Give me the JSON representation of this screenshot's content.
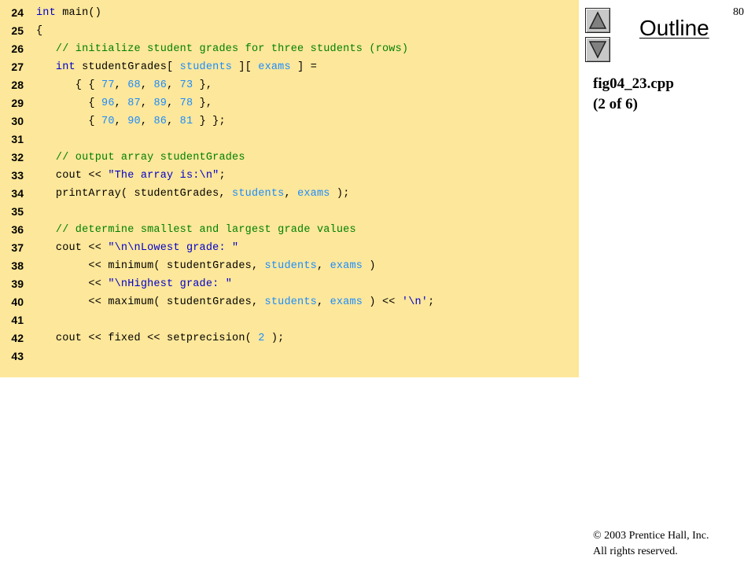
{
  "page_number": "80",
  "outline_label": "Outline",
  "file_name": "fig04_23.cpp",
  "part_label": "(2 of 6)",
  "copyright": {
    "line1": "© 2003 Prentice Hall, Inc.",
    "line2": "All rights reserved."
  },
  "nav": {
    "up_icon": "triangle-up-icon",
    "down_icon": "triangle-down-icon"
  },
  "colors": {
    "code_background": "#fde79a",
    "keyword": "#0000cc",
    "comment": "#008000",
    "string": "#0000cc",
    "number": "#1a8cff"
  },
  "code_lines": [
    {
      "n": "24",
      "tokens": [
        [
          "kw",
          "int"
        ],
        [
          "p",
          " main()"
        ]
      ]
    },
    {
      "n": "25",
      "tokens": [
        [
          "p",
          "{"
        ]
      ]
    },
    {
      "n": "26",
      "tokens": [
        [
          "p",
          "   "
        ],
        [
          "cm",
          "// initialize student grades for three students (rows)"
        ]
      ]
    },
    {
      "n": "27",
      "tokens": [
        [
          "p",
          "   "
        ],
        [
          "kw",
          "int"
        ],
        [
          "p",
          " studentGrades[ "
        ],
        [
          "id",
          "students"
        ],
        [
          "p",
          " ][ "
        ],
        [
          "id",
          "exams"
        ],
        [
          "p",
          " ] ="
        ]
      ]
    },
    {
      "n": "28",
      "tokens": [
        [
          "p",
          "      { { "
        ],
        [
          "nm",
          "77"
        ],
        [
          "p",
          ", "
        ],
        [
          "nm",
          "68"
        ],
        [
          "p",
          ", "
        ],
        [
          "nm",
          "86"
        ],
        [
          "p",
          ", "
        ],
        [
          "nm",
          "73"
        ],
        [
          "p",
          " },"
        ]
      ]
    },
    {
      "n": "29",
      "tokens": [
        [
          "p",
          "        { "
        ],
        [
          "nm",
          "96"
        ],
        [
          "p",
          ", "
        ],
        [
          "nm",
          "87"
        ],
        [
          "p",
          ", "
        ],
        [
          "nm",
          "89"
        ],
        [
          "p",
          ", "
        ],
        [
          "nm",
          "78"
        ],
        [
          "p",
          " },"
        ]
      ]
    },
    {
      "n": "30",
      "tokens": [
        [
          "p",
          "        { "
        ],
        [
          "nm",
          "70"
        ],
        [
          "p",
          ", "
        ],
        [
          "nm",
          "90"
        ],
        [
          "p",
          ", "
        ],
        [
          "nm",
          "86"
        ],
        [
          "p",
          ", "
        ],
        [
          "nm",
          "81"
        ],
        [
          "p",
          " } };"
        ]
      ]
    },
    {
      "n": "31",
      "tokens": []
    },
    {
      "n": "32",
      "tokens": [
        [
          "p",
          "   "
        ],
        [
          "cm",
          "// output array studentGrades"
        ]
      ]
    },
    {
      "n": "33",
      "tokens": [
        [
          "p",
          "   cout << "
        ],
        [
          "st",
          "\"The array is:\\n\""
        ],
        [
          "p",
          ";"
        ]
      ]
    },
    {
      "n": "34",
      "tokens": [
        [
          "p",
          "   printArray( studentGrades, "
        ],
        [
          "id",
          "students"
        ],
        [
          "p",
          ", "
        ],
        [
          "id",
          "exams"
        ],
        [
          "p",
          " );"
        ]
      ]
    },
    {
      "n": "35",
      "tokens": []
    },
    {
      "n": "36",
      "tokens": [
        [
          "p",
          "   "
        ],
        [
          "cm",
          "// determine smallest and largest grade values"
        ]
      ]
    },
    {
      "n": "37",
      "tokens": [
        [
          "p",
          "   cout << "
        ],
        [
          "st",
          "\"\\n\\nLowest grade: \""
        ]
      ]
    },
    {
      "n": "38",
      "tokens": [
        [
          "p",
          "        << minimum( studentGrades, "
        ],
        [
          "id",
          "students"
        ],
        [
          "p",
          ", "
        ],
        [
          "id",
          "exams"
        ],
        [
          "p",
          " )"
        ]
      ]
    },
    {
      "n": "39",
      "tokens": [
        [
          "p",
          "        << "
        ],
        [
          "st",
          "\"\\nHighest grade: \""
        ]
      ]
    },
    {
      "n": "40",
      "tokens": [
        [
          "p",
          "        << maximum( studentGrades, "
        ],
        [
          "id",
          "students"
        ],
        [
          "p",
          ", "
        ],
        [
          "id",
          "exams"
        ],
        [
          "p",
          " ) << "
        ],
        [
          "st",
          "'\\n'"
        ],
        [
          "p",
          ";"
        ]
      ]
    },
    {
      "n": "41",
      "tokens": []
    },
    {
      "n": "42",
      "tokens": [
        [
          "p",
          "   cout << fixed << setprecision( "
        ],
        [
          "nm",
          "2"
        ],
        [
          "p",
          " );"
        ]
      ]
    },
    {
      "n": "43",
      "tokens": []
    }
  ]
}
